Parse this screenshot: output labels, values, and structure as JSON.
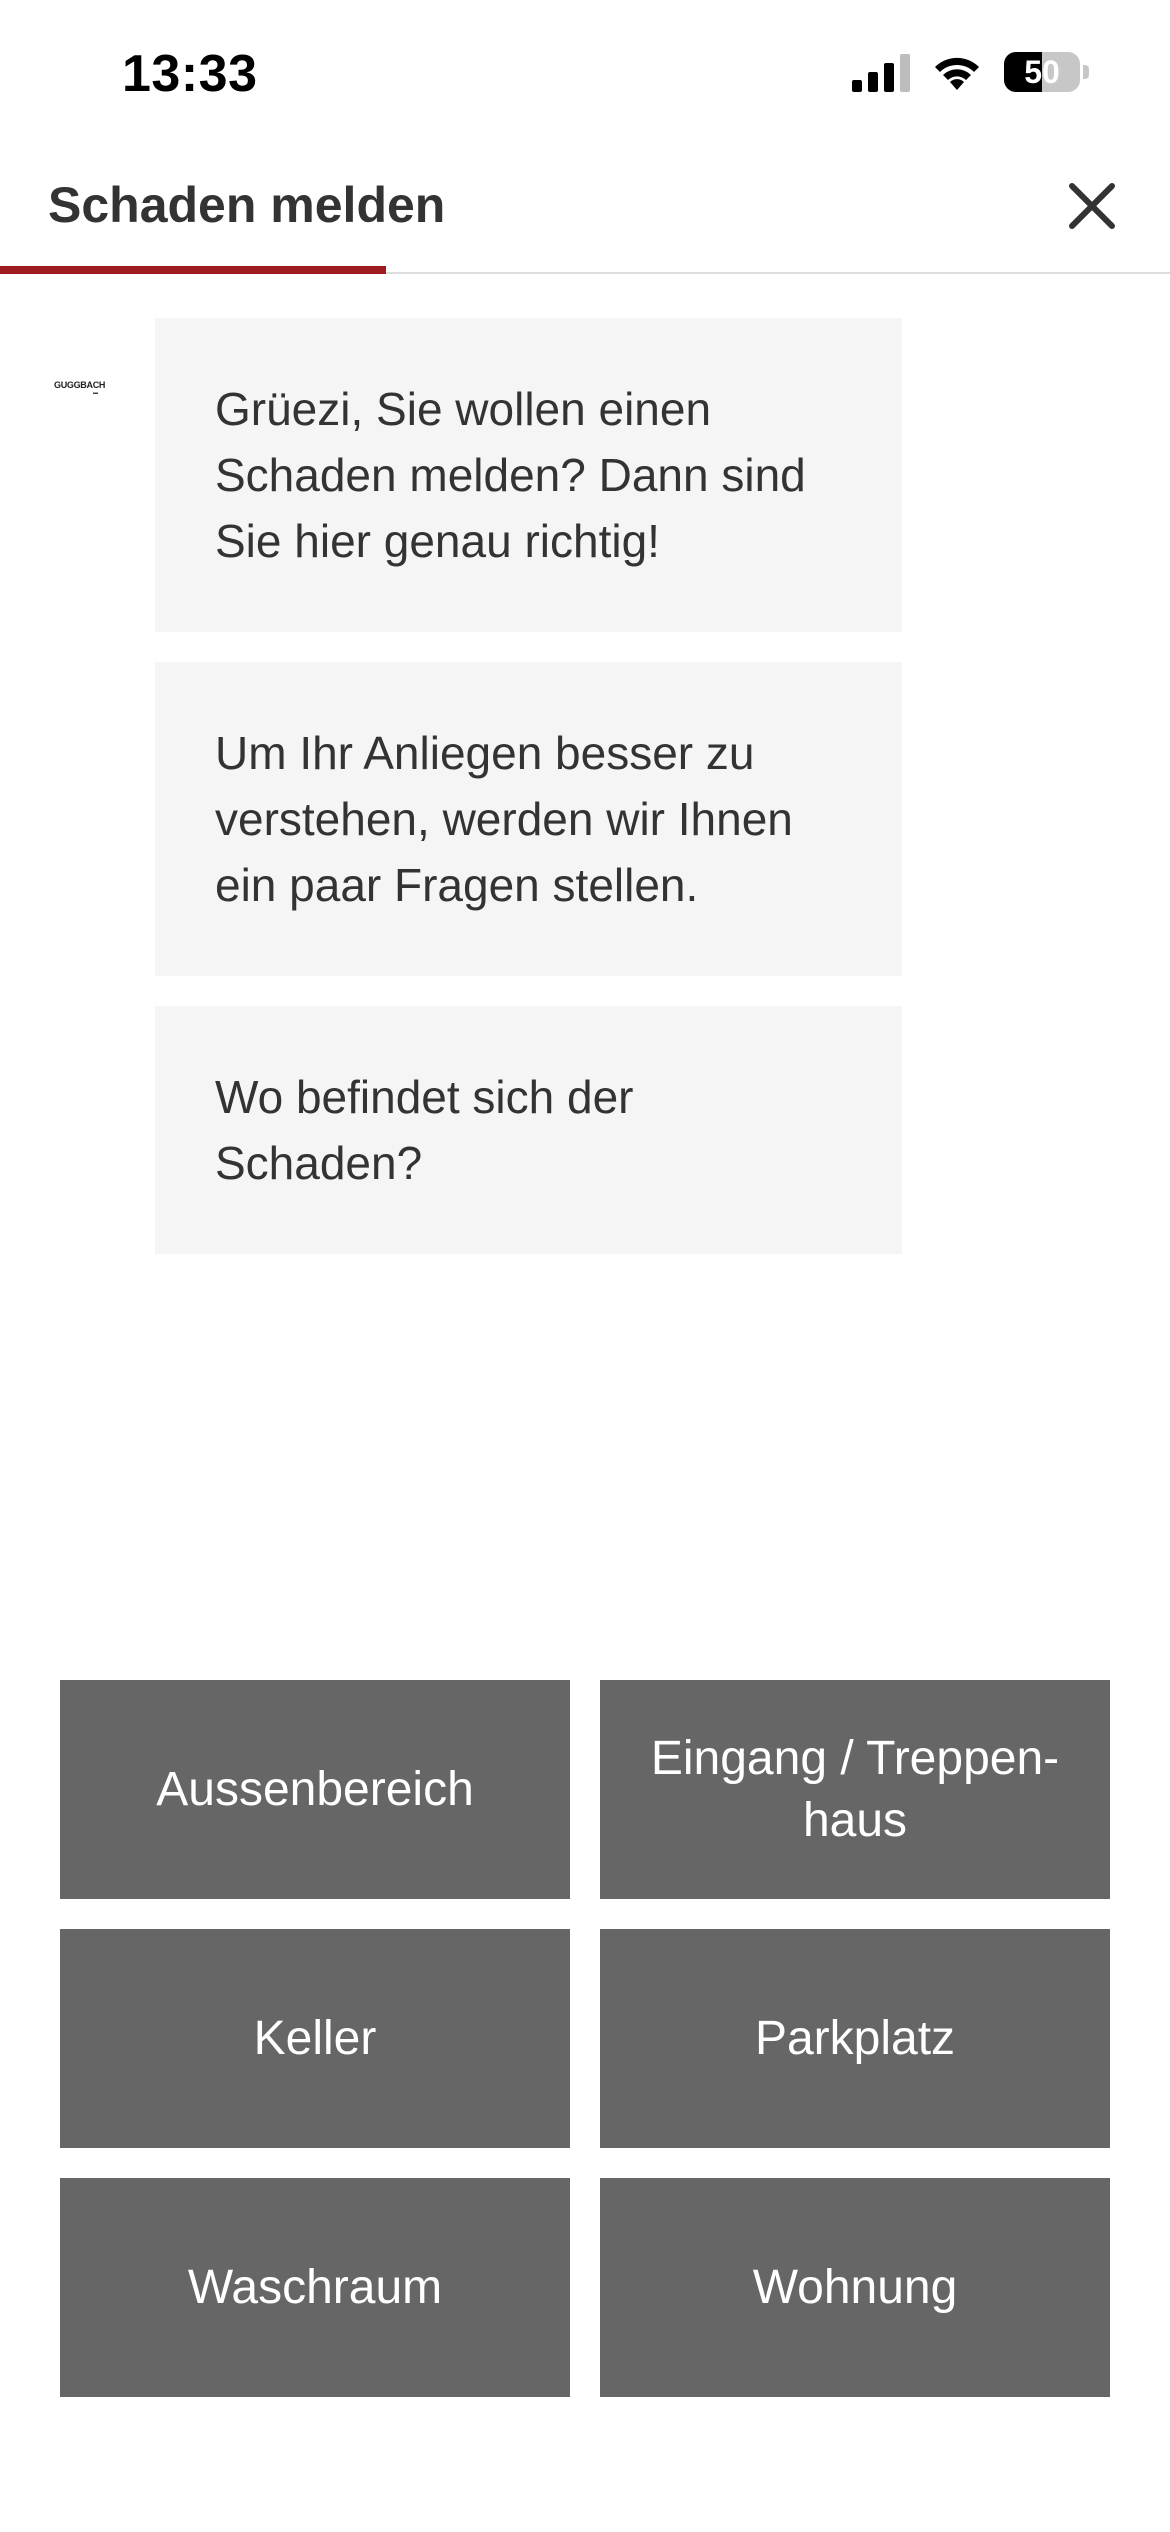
{
  "status_bar": {
    "time": "13:33",
    "battery_level": "50",
    "icons": [
      "signal-icon",
      "wifi-icon",
      "battery-icon"
    ]
  },
  "header": {
    "title": "Schaden melden",
    "close_icon": "close-icon",
    "progress_fraction": 0.33,
    "accent_color": "#9c1c1f"
  },
  "chat": {
    "avatar_logo": "GUGGBACH",
    "messages": [
      "Grüezi, Sie wollen einen Schaden melden? Dann sind Sie hier genau richtig!",
      "Um Ihr Anliegen besser zu verstehen, werden wir Ihnen ein paar Fragen stellen.",
      "Wo befindet sich der Schaden?"
    ]
  },
  "options": [
    "Aussenbereich",
    "Eingang / Treppen-haus",
    "Keller",
    "Parkplatz",
    "Waschraum",
    "Wohnung"
  ],
  "colors": {
    "button_bg": "#666666",
    "bubble_bg": "#f5f5f5",
    "text": "#333333"
  }
}
